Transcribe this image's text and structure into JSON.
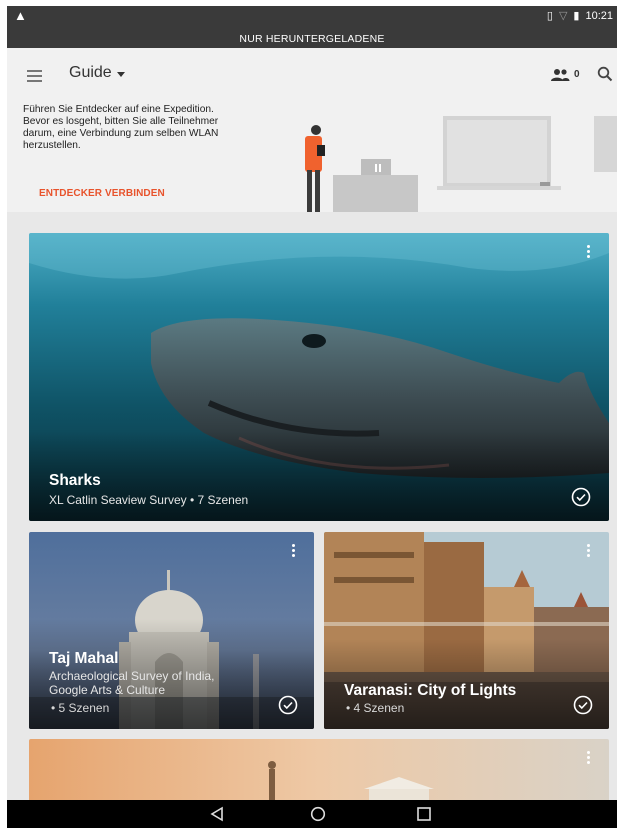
{
  "status_bar": {
    "warning_icon": "warning-icon",
    "time": "10:21",
    "banner": "NUR HERUNTERGELADENE"
  },
  "toolbar": {
    "title": "Guide",
    "explorer_count": "0"
  },
  "connect": {
    "text": "Führen Sie Entdecker auf eine Expedition. Bevor es losgeht, bitten Sie alle Teilnehmer darum, eine Verbindung zum selben WLAN herzustellen.",
    "button": "ENTDECKER VERBINDEN"
  },
  "cards": [
    {
      "title": "Sharks",
      "subtitle": "XL Catlin Seaview Survey • 7 Szenen",
      "downloaded": true
    },
    {
      "title": "Taj Mahal",
      "subtitle_line1": "Archaeological Survey of India,",
      "subtitle_line2": "Google Arts & Culture",
      "scenes": "• 5 Szenen",
      "downloaded": true
    },
    {
      "title": "Varanasi: City of Lights",
      "scenes": "• 4 Szenen",
      "downloaded": true
    },
    {
      "title": "",
      "downloaded": false
    }
  ],
  "colors": {
    "accent": "#e8532c",
    "statusbar": "#3a3a3a",
    "background": "#f1f1f1"
  }
}
